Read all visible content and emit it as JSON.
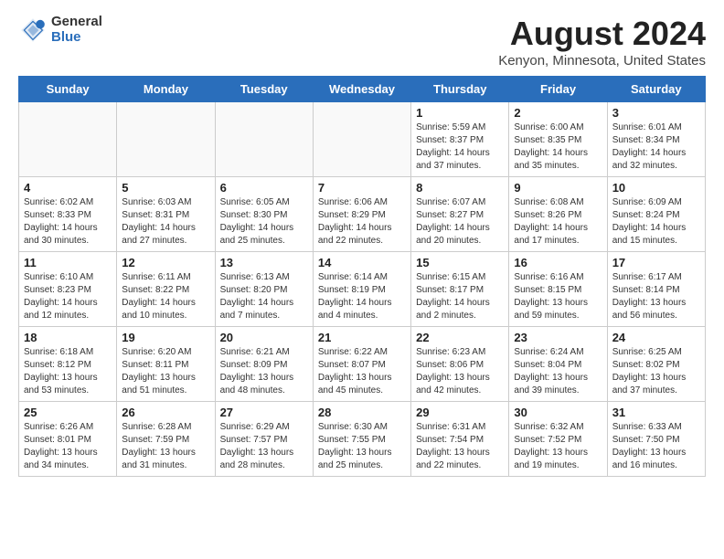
{
  "header": {
    "logo_general": "General",
    "logo_blue": "Blue",
    "title": "August 2024",
    "subtitle": "Kenyon, Minnesota, United States"
  },
  "days_of_week": [
    "Sunday",
    "Monday",
    "Tuesday",
    "Wednesday",
    "Thursday",
    "Friday",
    "Saturday"
  ],
  "weeks": [
    [
      {
        "day": "",
        "info": ""
      },
      {
        "day": "",
        "info": ""
      },
      {
        "day": "",
        "info": ""
      },
      {
        "day": "",
        "info": ""
      },
      {
        "day": "1",
        "info": "Sunrise: 5:59 AM\nSunset: 8:37 PM\nDaylight: 14 hours\nand 37 minutes."
      },
      {
        "day": "2",
        "info": "Sunrise: 6:00 AM\nSunset: 8:35 PM\nDaylight: 14 hours\nand 35 minutes."
      },
      {
        "day": "3",
        "info": "Sunrise: 6:01 AM\nSunset: 8:34 PM\nDaylight: 14 hours\nand 32 minutes."
      }
    ],
    [
      {
        "day": "4",
        "info": "Sunrise: 6:02 AM\nSunset: 8:33 PM\nDaylight: 14 hours\nand 30 minutes."
      },
      {
        "day": "5",
        "info": "Sunrise: 6:03 AM\nSunset: 8:31 PM\nDaylight: 14 hours\nand 27 minutes."
      },
      {
        "day": "6",
        "info": "Sunrise: 6:05 AM\nSunset: 8:30 PM\nDaylight: 14 hours\nand 25 minutes."
      },
      {
        "day": "7",
        "info": "Sunrise: 6:06 AM\nSunset: 8:29 PM\nDaylight: 14 hours\nand 22 minutes."
      },
      {
        "day": "8",
        "info": "Sunrise: 6:07 AM\nSunset: 8:27 PM\nDaylight: 14 hours\nand 20 minutes."
      },
      {
        "day": "9",
        "info": "Sunrise: 6:08 AM\nSunset: 8:26 PM\nDaylight: 14 hours\nand 17 minutes."
      },
      {
        "day": "10",
        "info": "Sunrise: 6:09 AM\nSunset: 8:24 PM\nDaylight: 14 hours\nand 15 minutes."
      }
    ],
    [
      {
        "day": "11",
        "info": "Sunrise: 6:10 AM\nSunset: 8:23 PM\nDaylight: 14 hours\nand 12 minutes."
      },
      {
        "day": "12",
        "info": "Sunrise: 6:11 AM\nSunset: 8:22 PM\nDaylight: 14 hours\nand 10 minutes."
      },
      {
        "day": "13",
        "info": "Sunrise: 6:13 AM\nSunset: 8:20 PM\nDaylight: 14 hours\nand 7 minutes."
      },
      {
        "day": "14",
        "info": "Sunrise: 6:14 AM\nSunset: 8:19 PM\nDaylight: 14 hours\nand 4 minutes."
      },
      {
        "day": "15",
        "info": "Sunrise: 6:15 AM\nSunset: 8:17 PM\nDaylight: 14 hours\nand 2 minutes."
      },
      {
        "day": "16",
        "info": "Sunrise: 6:16 AM\nSunset: 8:15 PM\nDaylight: 13 hours\nand 59 minutes."
      },
      {
        "day": "17",
        "info": "Sunrise: 6:17 AM\nSunset: 8:14 PM\nDaylight: 13 hours\nand 56 minutes."
      }
    ],
    [
      {
        "day": "18",
        "info": "Sunrise: 6:18 AM\nSunset: 8:12 PM\nDaylight: 13 hours\nand 53 minutes."
      },
      {
        "day": "19",
        "info": "Sunrise: 6:20 AM\nSunset: 8:11 PM\nDaylight: 13 hours\nand 51 minutes."
      },
      {
        "day": "20",
        "info": "Sunrise: 6:21 AM\nSunset: 8:09 PM\nDaylight: 13 hours\nand 48 minutes."
      },
      {
        "day": "21",
        "info": "Sunrise: 6:22 AM\nSunset: 8:07 PM\nDaylight: 13 hours\nand 45 minutes."
      },
      {
        "day": "22",
        "info": "Sunrise: 6:23 AM\nSunset: 8:06 PM\nDaylight: 13 hours\nand 42 minutes."
      },
      {
        "day": "23",
        "info": "Sunrise: 6:24 AM\nSunset: 8:04 PM\nDaylight: 13 hours\nand 39 minutes."
      },
      {
        "day": "24",
        "info": "Sunrise: 6:25 AM\nSunset: 8:02 PM\nDaylight: 13 hours\nand 37 minutes."
      }
    ],
    [
      {
        "day": "25",
        "info": "Sunrise: 6:26 AM\nSunset: 8:01 PM\nDaylight: 13 hours\nand 34 minutes."
      },
      {
        "day": "26",
        "info": "Sunrise: 6:28 AM\nSunset: 7:59 PM\nDaylight: 13 hours\nand 31 minutes."
      },
      {
        "day": "27",
        "info": "Sunrise: 6:29 AM\nSunset: 7:57 PM\nDaylight: 13 hours\nand 28 minutes."
      },
      {
        "day": "28",
        "info": "Sunrise: 6:30 AM\nSunset: 7:55 PM\nDaylight: 13 hours\nand 25 minutes."
      },
      {
        "day": "29",
        "info": "Sunrise: 6:31 AM\nSunset: 7:54 PM\nDaylight: 13 hours\nand 22 minutes."
      },
      {
        "day": "30",
        "info": "Sunrise: 6:32 AM\nSunset: 7:52 PM\nDaylight: 13 hours\nand 19 minutes."
      },
      {
        "day": "31",
        "info": "Sunrise: 6:33 AM\nSunset: 7:50 PM\nDaylight: 13 hours\nand 16 minutes."
      }
    ]
  ]
}
